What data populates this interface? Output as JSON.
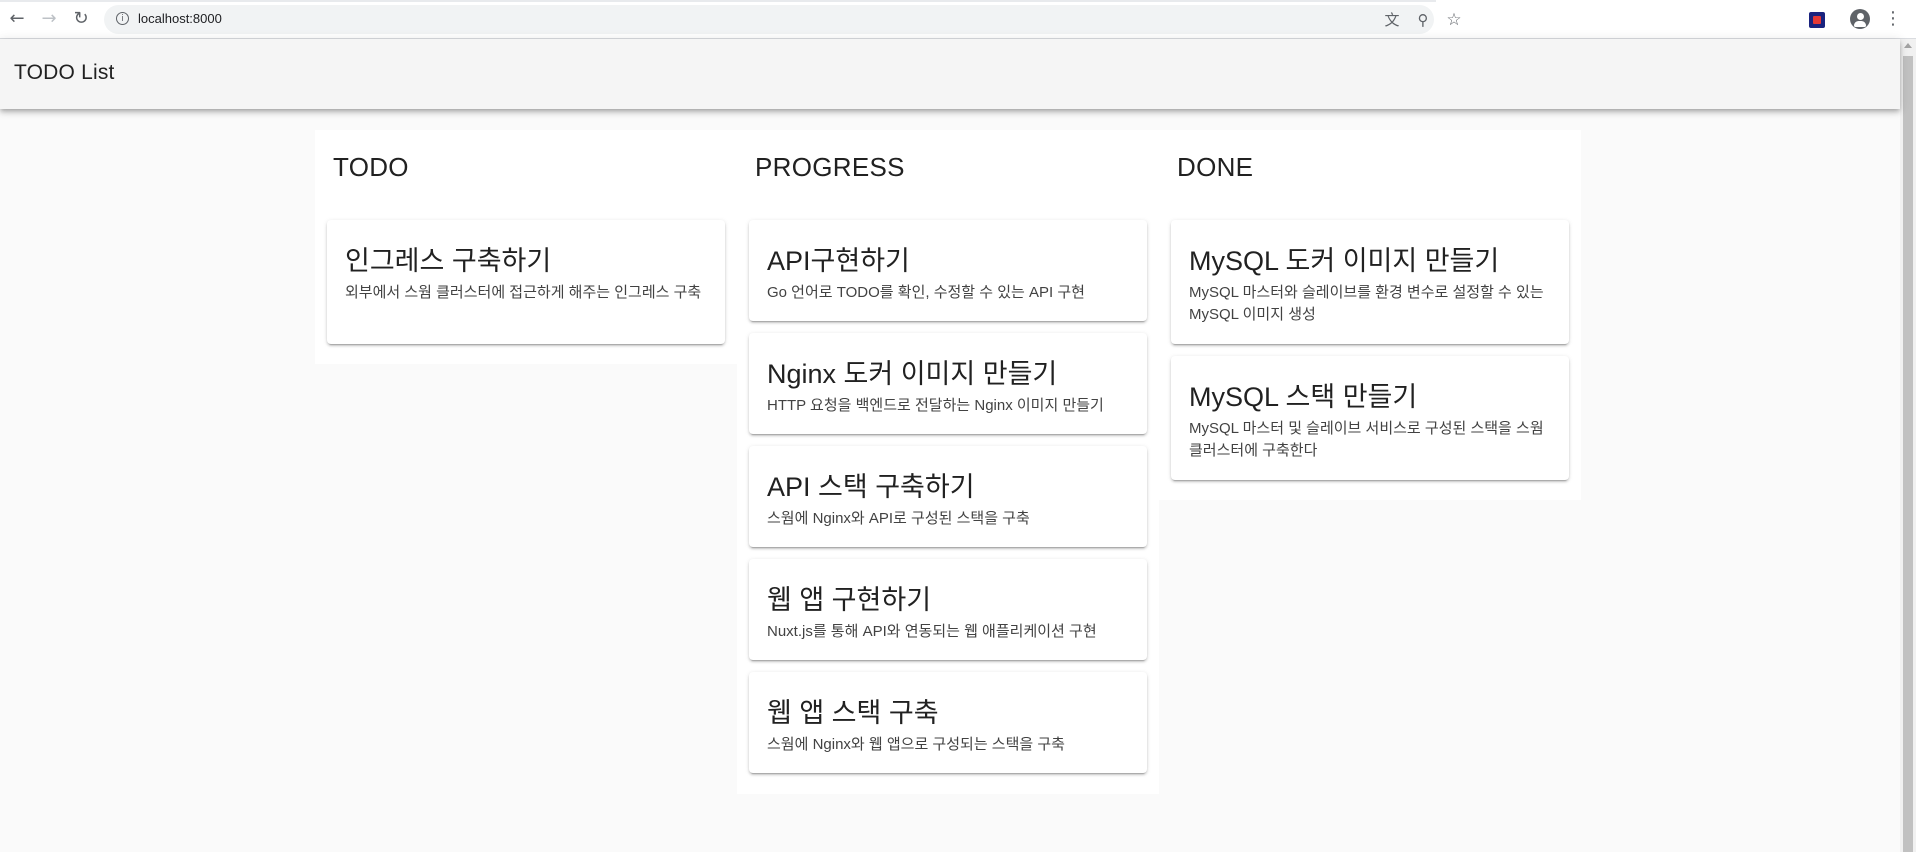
{
  "browser": {
    "url": "localhost:8000",
    "info_glyph": "i",
    "back_icon": "arrow-left-icon",
    "forward_icon": "arrow-right-icon",
    "reload_icon": "reload-icon"
  },
  "app": {
    "title": "TODO List"
  },
  "columns": [
    {
      "title": "TODO",
      "cards": [
        {
          "title": "인그레스 구축하기",
          "description": "외부에서 스웜 클러스터에 접근하게 해주는 인그레스 구축"
        }
      ]
    },
    {
      "title": "PROGRESS",
      "cards": [
        {
          "title": "API구현하기",
          "description": "Go 언어로 TODO를 확인, 수정할 수 있는 API 구현"
        },
        {
          "title": "Nginx 도커 이미지 만들기",
          "description": "HTTP 요청을 백엔드로 전달하는 Nginx 이미지 만들기"
        },
        {
          "title": "API 스택 구축하기",
          "description": "스웜에 Nginx와 API로 구성된 스택을 구축"
        },
        {
          "title": "웹 앱 구현하기",
          "description": "Nuxt.js를 통해 API와 연동되는 웹 애플리케이션 구현"
        },
        {
          "title": "웹 앱 스택 구축",
          "description": "스웜에 Nginx와 웹 앱으로 구성되는 스택을 구축"
        }
      ]
    },
    {
      "title": "DONE",
      "cards": [
        {
          "title": "MySQL 도커 이미지 만들기",
          "description": "MySQL 마스터와 슬레이브를 환경 변수로 설정할 수 있는 MySQL 이미지 생성"
        },
        {
          "title": "MySQL 스택 만들기",
          "description": "MySQL 마스터 및 슬레이브 서비스로 구성된 스택을 스웜 클러스터에 구축한다"
        }
      ]
    }
  ],
  "colors": {
    "page_background": "#fafafa",
    "toolbar_background": "#f5f5f5",
    "card_background": "#ffffff",
    "text_primary": "#212121"
  }
}
